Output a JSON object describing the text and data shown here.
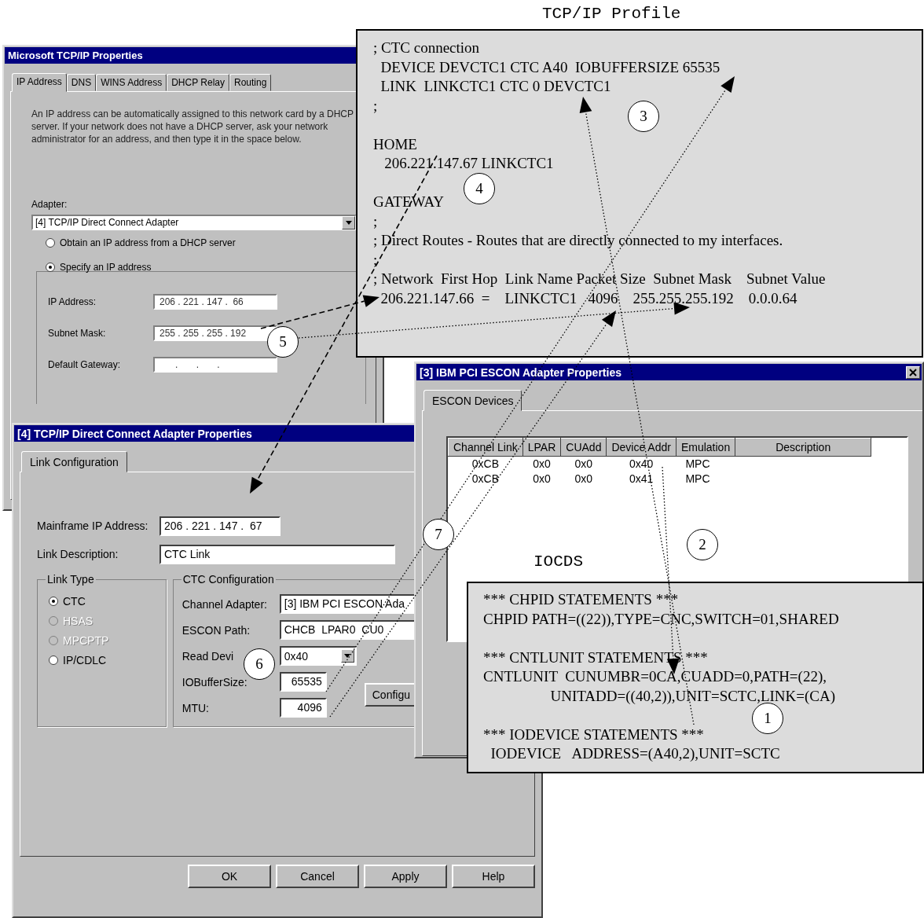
{
  "profile_label": "TCP/IP Profile",
  "tcpip_window": {
    "title": "Microsoft TCP/IP Properties",
    "tabs": [
      {
        "label": "IP Address",
        "selected": true
      },
      {
        "label": "DNS",
        "selected": false
      },
      {
        "label": "WINS Address",
        "selected": false
      },
      {
        "label": "DHCP Relay",
        "selected": false
      },
      {
        "label": "Routing",
        "selected": false
      }
    ],
    "description": "An IP address can be automatically assigned to this network card by a DHCP server.  If your network does not have a DHCP server, ask your network administrator for an address, and then type it in the space below.",
    "adapter_label": "Adapter:",
    "adapter": "[4] TCP/IP Direct Connect Adapter",
    "options": [
      {
        "label": "Obtain an IP address from a DHCP server",
        "selected": false
      },
      {
        "label": "Specify an IP address",
        "selected": true
      }
    ],
    "fields": [
      {
        "label": "IP Address:",
        "value": "206 . 221 . 147 .  66"
      },
      {
        "label": "Subnet Mask:",
        "value": "255 . 255 . 255 . 192"
      },
      {
        "label": "Default Gateway:",
        "value": "      .       .       ."
      }
    ]
  },
  "profile": {
    "lines": [
      {
        "text": "; CTC connection",
        "space_before": false
      },
      {
        "text": "  DEVICE DEVCTC1 CTC A40  IOBUFFERSIZE 65535",
        "space_before": false
      },
      {
        "text": "  LINK  LINKCTC1 CTC 0 DEVCTC1",
        "space_before": false
      },
      {
        "text": ";",
        "space_before": false
      },
      {
        "text": "HOME",
        "space_before": true
      },
      {
        "text": "   206.221.147.67 LINKCTC1",
        "space_before": false
      },
      {
        "text": "GATEWAY",
        "space_before": true
      },
      {
        "text": ";",
        "space_before": false
      },
      {
        "text": "; Direct Routes - Routes that are directly connected to my interfaces.",
        "space_before": false
      },
      {
        "text": ";",
        "space_before": false
      },
      {
        "text": "; Network  First Hop  Link Name Packet Size  Subnet Mask    Subnet Value",
        "space_before": false
      },
      {
        "text": "  206.221.147.66  =    LINKCTC1   4096    255.255.255.192    0.0.0.64",
        "space_before": false
      }
    ]
  },
  "escon_window": {
    "title": "[3] IBM PCI ESCON Adapter Properties",
    "tabs": [
      {
        "label": "ESCON Devices",
        "selected": true
      }
    ],
    "columns": [
      "Channel Link",
      "LPAR",
      "CUAdd",
      "Device Addr",
      "Emulation",
      "Description"
    ],
    "rows": [
      [
        "0xCB",
        "0x0",
        "0x0",
        "0x40",
        "MPC"
      ],
      [
        "0xCB",
        "0x0",
        "0x0",
        "0x41",
        "MPC"
      ]
    ]
  },
  "iocds_label": "IOCDS",
  "iocds": {
    "lines": [
      {
        "text": "*** CHPID STATEMENTS ***",
        "space_before": false
      },
      {
        "text": "CHPID PATH=((22)),TYPE=CNC,SWITCH=01,SHARED",
        "space_before": false
      },
      {
        "text": "*** CNTLUNIT STATEMENTS ***",
        "space_before": true
      },
      {
        "text": "CNTLUNIT  CUNUMBR=0CA,CUADD=0,PATH=(22),",
        "space_before": false
      },
      {
        "text": "                  UNITADD=((40,2)),UNIT=SCTC,LINK=(CA)",
        "space_before": false
      },
      {
        "text": "*** IODEVICE STATEMENTS ***",
        "space_before": true
      },
      {
        "text": "  IODEVICE   ADDRESS=(A40,2),UNIT=SCTC",
        "space_before": false
      }
    ]
  },
  "adapter_window": {
    "title": "[4] TCP/IP Direct Connect Adapter Properties",
    "tabs": [
      {
        "label": "Link Configuration",
        "selected": true
      }
    ],
    "mainframe_ip_label": "Mainframe IP Address:",
    "mainframe_ip": "206 . 221 . 147 .  67",
    "link_description_label": "Link Description:",
    "link_description": "CTC Link",
    "link_type": {
      "title": "Link Type",
      "options": [
        {
          "label": "CTC",
          "selected": true,
          "disabled": false
        },
        {
          "label": "HSAS",
          "selected": false,
          "disabled": true
        },
        {
          "label": "MPCPTP",
          "selected": false,
          "disabled": true
        },
        {
          "label": "IP/CDLC",
          "selected": false,
          "disabled": false
        }
      ]
    },
    "ctc": {
      "title": "CTC Configuration",
      "fields": [
        {
          "label": "Channel Adapter:",
          "value": "[3] IBM PCI ESCON Ada",
          "kind": "text"
        },
        {
          "label": "ESCON Path:",
          "value": "CHCB  LPAR0  CU0",
          "kind": "text"
        },
        {
          "label": "Read Devi",
          "value": "0x40",
          "kind": "dropdown"
        },
        {
          "label": "IOBufferSize:",
          "value": "65535",
          "kind": "number"
        },
        {
          "label": "MTU:",
          "value": "4096",
          "kind": "number"
        }
      ]
    },
    "configure_button": "Configu",
    "buttons": [
      "OK",
      "Cancel",
      "Apply",
      "Help"
    ]
  },
  "callouts": [
    "1",
    "2",
    "3",
    "4",
    "5",
    "6",
    "7"
  ]
}
